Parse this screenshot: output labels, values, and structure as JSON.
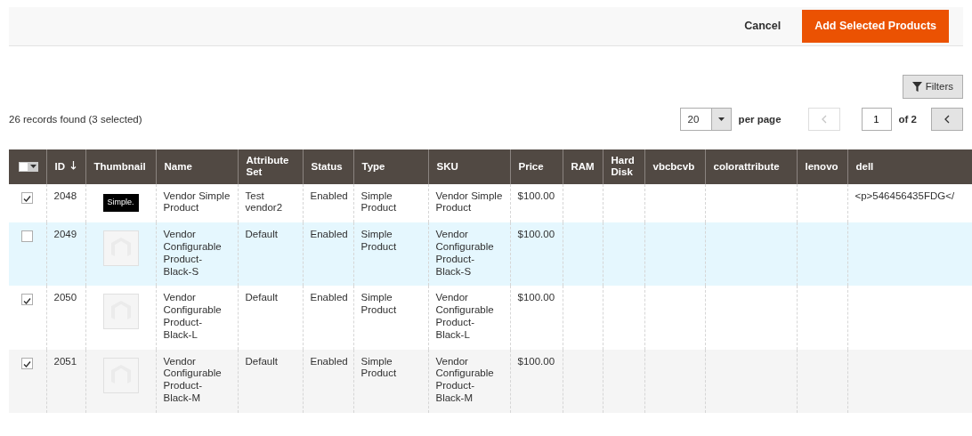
{
  "header_actions": {
    "cancel": "Cancel",
    "primary": "Add Selected Products"
  },
  "filters_button": "Filters",
  "records": "26 records found (3 selected)",
  "pager": {
    "per_page_value": "20",
    "per_page_label": "per page",
    "prev_disabled": true,
    "page": "1",
    "of": "of 2",
    "next_disabled": false
  },
  "table": {
    "columns": [
      {
        "kind": "mass-select"
      },
      {
        "label": "ID",
        "kind": "text",
        "sorted": true
      },
      {
        "label": "Thumbnail",
        "kind": "text",
        "sorted": false
      },
      {
        "label": "Name",
        "kind": "text",
        "sorted": false
      },
      {
        "label": "Attribute Set",
        "kind": "text",
        "sorted": false
      },
      {
        "label": "Status",
        "kind": "text",
        "sorted": false
      },
      {
        "label": "Type",
        "kind": "text",
        "sorted": false
      },
      {
        "label": "SKU",
        "kind": "text",
        "sorted": false
      },
      {
        "label": "Price",
        "kind": "text",
        "sorted": false
      },
      {
        "label": "RAM",
        "kind": "text",
        "sorted": false
      },
      {
        "label": "Hard Disk",
        "kind": "text",
        "sorted": false
      },
      {
        "label": "vbcbcvb",
        "kind": "text",
        "sorted": false
      },
      {
        "label": "colorattribute",
        "kind": "text",
        "sorted": false
      },
      {
        "label": "lenovo",
        "kind": "text",
        "sorted": false
      },
      {
        "label": "dell",
        "kind": "text",
        "sorted": false
      }
    ],
    "rows": [
      {
        "checked": true,
        "highlighted": false,
        "id": "2048",
        "thumbnail": {
          "kind": "logo",
          "text": "Simple."
        },
        "name": "Vendor Simple Product",
        "attribute_set": "Test vendor2",
        "status": "Enabled",
        "type": "Simple Product",
        "sku": "Vendor Simple Product",
        "price": "$100.00",
        "dell": "<p>546456435FDG</"
      },
      {
        "checked": false,
        "highlighted": true,
        "id": "2049",
        "thumbnail": {
          "kind": "placeholder"
        },
        "name": "Vendor Configurable Product-Black-S",
        "attribute_set": "Default",
        "status": "Enabled",
        "type": "Simple Product",
        "sku": "Vendor Configurable Product-Black-S",
        "price": "$100.00"
      },
      {
        "checked": true,
        "highlighted": false,
        "id": "2050",
        "thumbnail": {
          "kind": "placeholder"
        },
        "name": "Vendor Configurable Product-Black-L",
        "attribute_set": "Default",
        "status": "Enabled",
        "type": "Simple Product",
        "sku": "Vendor Configurable Product-Black-L",
        "price": "$100.00"
      },
      {
        "checked": true,
        "highlighted": false,
        "id": "2051",
        "thumbnail": {
          "kind": "placeholder"
        },
        "name": "Vendor Configurable Product-Black-M",
        "attribute_set": "Default",
        "status": "Enabled",
        "type": "Simple Product",
        "sku": "Vendor Configurable Product-Black-M",
        "price": "$100.00"
      }
    ]
  }
}
